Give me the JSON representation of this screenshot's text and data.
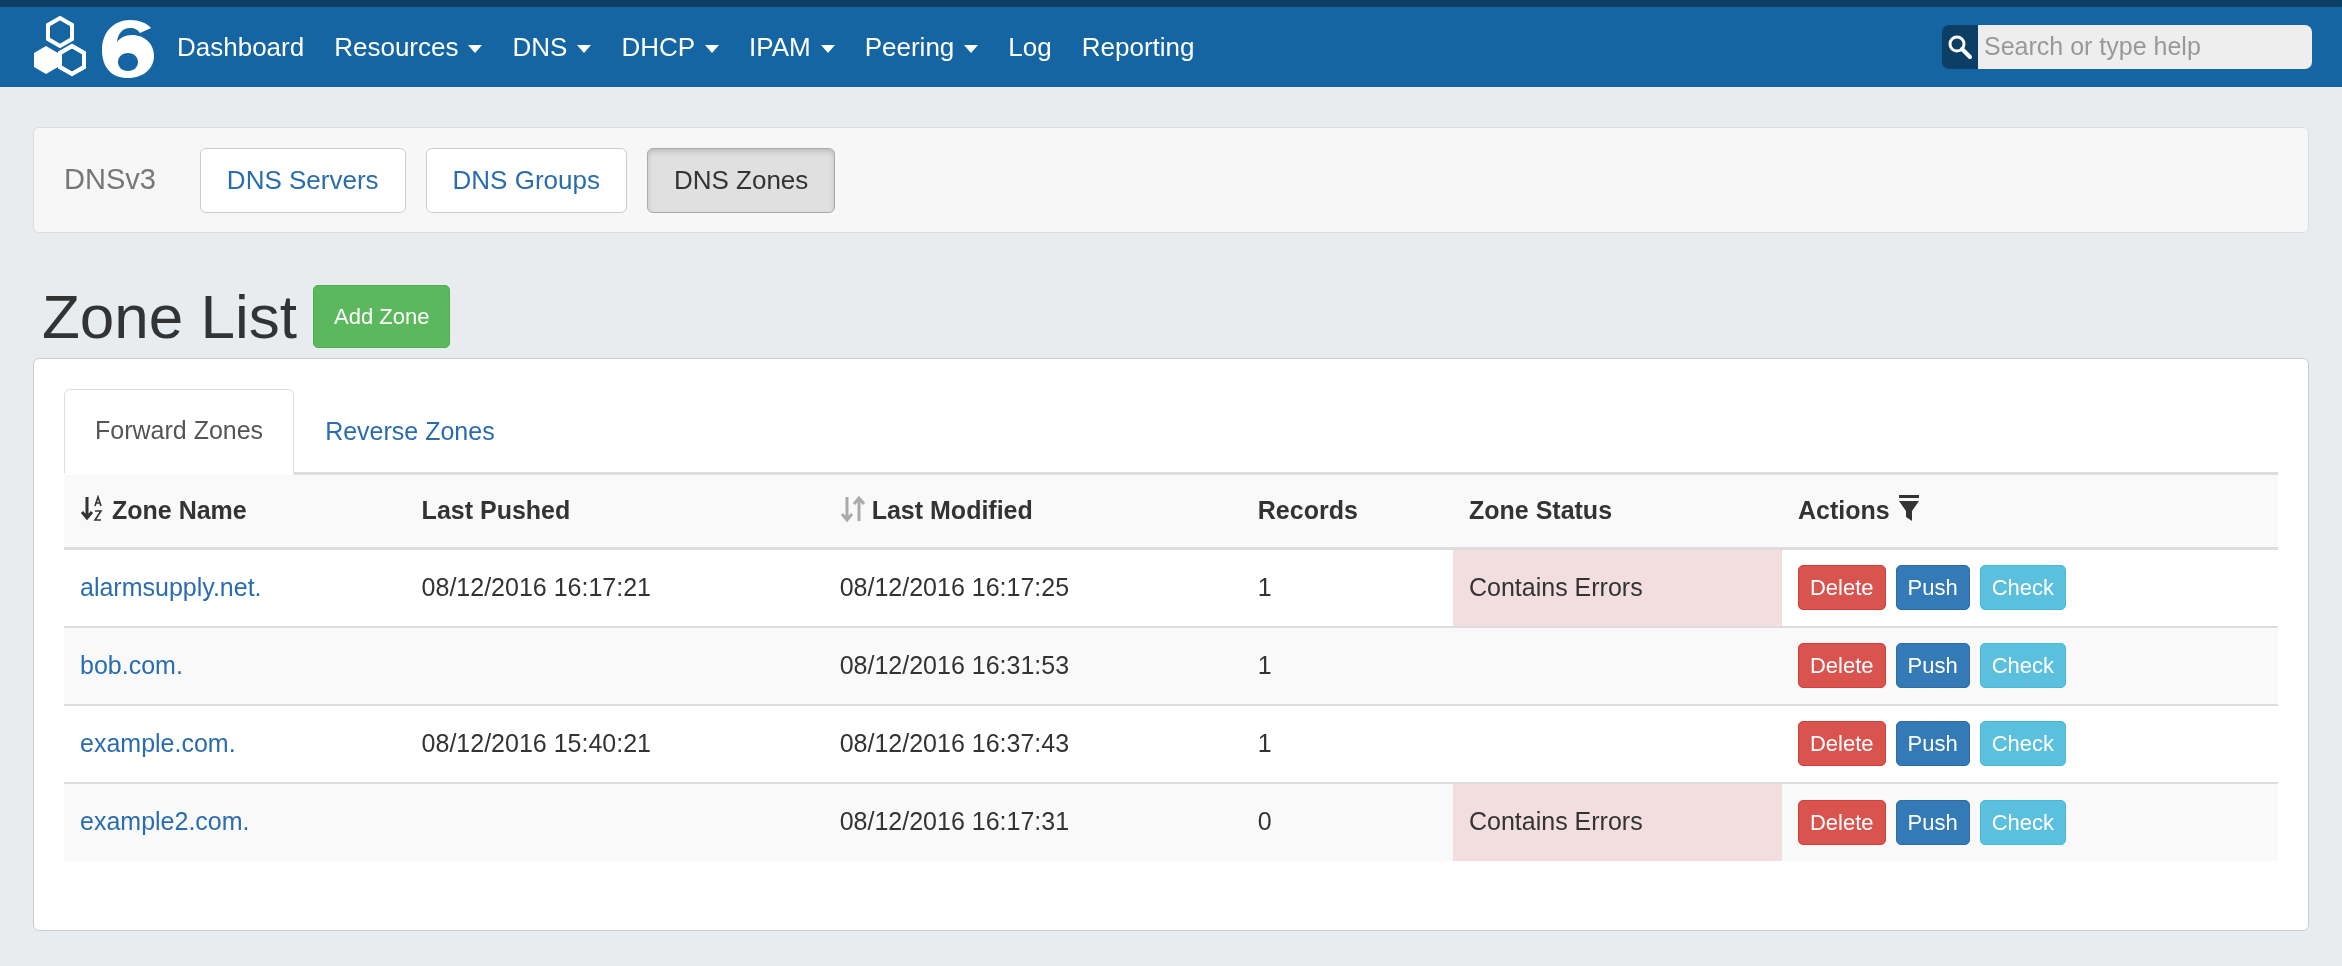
{
  "navbar": {
    "items": [
      {
        "label": "Dashboard",
        "dropdown": false
      },
      {
        "label": "Resources",
        "dropdown": true
      },
      {
        "label": "DNS",
        "dropdown": true
      },
      {
        "label": "DHCP",
        "dropdown": true
      },
      {
        "label": "IPAM",
        "dropdown": true
      },
      {
        "label": "Peering",
        "dropdown": true
      },
      {
        "label": "Log",
        "dropdown": false
      },
      {
        "label": "Reporting",
        "dropdown": false
      }
    ],
    "search": {
      "placeholder": "Search or type help"
    }
  },
  "subnav": {
    "title": "DNSv3",
    "buttons": [
      {
        "label": "DNS Servers",
        "selected": false
      },
      {
        "label": "DNS Groups",
        "selected": false
      },
      {
        "label": "DNS Zones",
        "selected": true
      }
    ]
  },
  "heading": "Zone List",
  "add_button": "Add Zone",
  "tabs": [
    {
      "label": "Forward Zones",
      "selected": true
    },
    {
      "label": "Reverse Zones",
      "selected": false
    }
  ],
  "table": {
    "columns": [
      {
        "label": "Zone Name",
        "kind": "alpha"
      },
      {
        "label": "Last Pushed",
        "kind": "plain"
      },
      {
        "label": "Last Modified",
        "kind": "both"
      },
      {
        "label": "Records",
        "kind": "plain"
      },
      {
        "label": "Zone Status",
        "kind": "plain"
      },
      {
        "label": "Actions",
        "kind": "filter"
      }
    ],
    "rows": [
      {
        "zone": "alarmsupply.net.",
        "last_pushed": "08/12/2016 16:17:21",
        "last_modified": "08/12/2016 16:17:25",
        "records": "1",
        "status": "Contains Errors",
        "error": true,
        "actions": [
          {
            "label": "Delete",
            "kind": "danger"
          },
          {
            "label": "Push",
            "kind": "primary"
          },
          {
            "label": "Check",
            "kind": "info"
          }
        ]
      },
      {
        "zone": "bob.com.",
        "last_pushed": "",
        "last_modified": "08/12/2016 16:31:53",
        "records": "1",
        "status": "",
        "error": false,
        "actions": [
          {
            "label": "Delete",
            "kind": "danger"
          },
          {
            "label": "Push",
            "kind": "primary"
          },
          {
            "label": "Check",
            "kind": "info"
          }
        ]
      },
      {
        "zone": "example.com.",
        "last_pushed": "08/12/2016 15:40:21",
        "last_modified": "08/12/2016 16:37:43",
        "records": "1",
        "status": "",
        "error": false,
        "actions": [
          {
            "label": "Delete",
            "kind": "danger"
          },
          {
            "label": "Push",
            "kind": "primary"
          },
          {
            "label": "Check",
            "kind": "info"
          }
        ]
      },
      {
        "zone": "example2.com.",
        "last_pushed": "",
        "last_modified": "08/12/2016 16:17:31",
        "records": "0",
        "status": "Contains Errors",
        "error": true,
        "actions": [
          {
            "label": "Delete",
            "kind": "danger"
          },
          {
            "label": "Push",
            "kind": "primary"
          },
          {
            "label": "Check",
            "kind": "info"
          }
        ]
      }
    ]
  }
}
